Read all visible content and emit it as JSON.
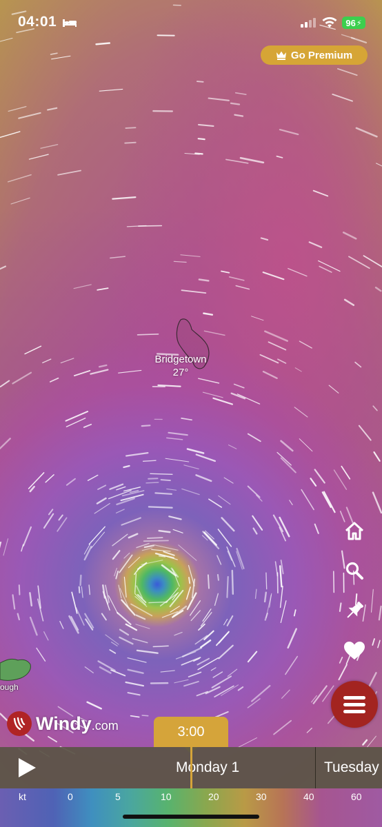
{
  "status_bar": {
    "time": "04:01",
    "battery": "96"
  },
  "premium": {
    "label": "Go Premium"
  },
  "map": {
    "city": "Bridgetown",
    "temperature": "27°",
    "partial_label": "ough"
  },
  "brand": {
    "name": "Windy",
    "domain": ".com"
  },
  "timeline": {
    "current_time": "3:00",
    "day_current": "Monday 1",
    "day_next": "Tuesday"
  },
  "scale": {
    "unit": "kt",
    "ticks": [
      "0",
      "5",
      "10",
      "20",
      "30",
      "40",
      "60"
    ]
  },
  "colors": {
    "accent": "#d5a43a",
    "menu": "#a32420",
    "brand": "#b02425"
  },
  "icons": [
    "home-icon",
    "search-icon",
    "pin-icon",
    "heart-icon",
    "menu-icon",
    "play-icon",
    "crown-icon"
  ]
}
